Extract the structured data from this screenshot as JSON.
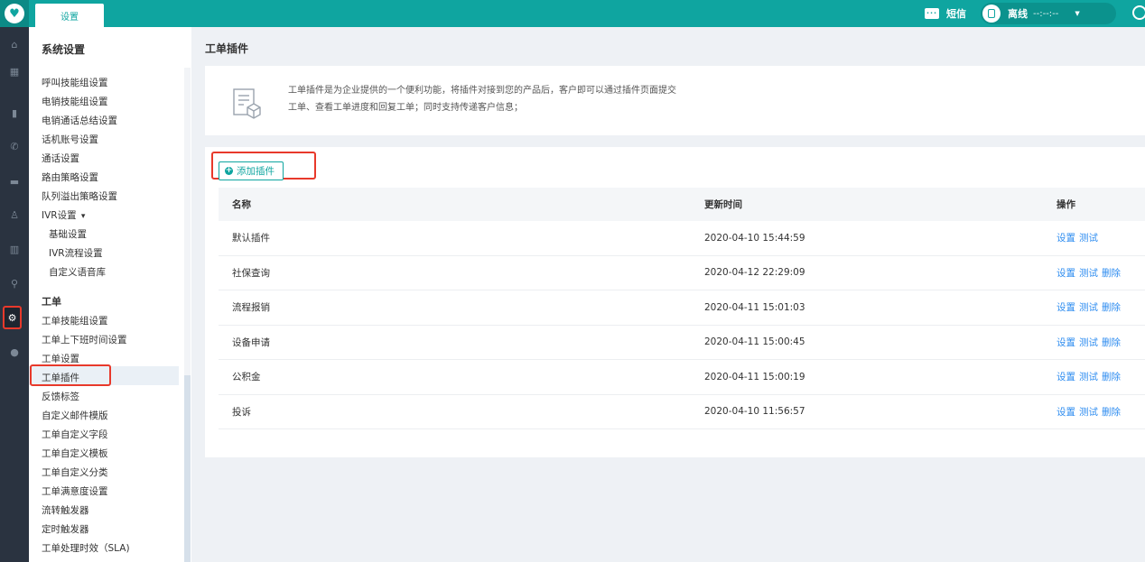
{
  "topbar": {
    "active_tab": "设置",
    "sms_label": "短信",
    "status_label": "离线",
    "status_time": "--:--:--"
  },
  "rail": {
    "icons": [
      "home-icon",
      "grid-icon",
      "book-icon",
      "phone-icon",
      "chat-icon",
      "users-icon",
      "chart-icon",
      "search-icon",
      "gear-icon",
      "github-icon"
    ],
    "active": "gear-icon"
  },
  "nav": {
    "title": "系统设置",
    "items": [
      {
        "label": "呼叫技能组设置"
      },
      {
        "label": "电销技能组设置"
      },
      {
        "label": "电销通话总结设置"
      },
      {
        "label": "话机账号设置"
      },
      {
        "label": "通话设置"
      },
      {
        "label": "路由策略设置"
      },
      {
        "label": "队列溢出策略设置"
      },
      {
        "label": "IVR设置"
      }
    ],
    "ivr_caret": "▾",
    "ivr_children": [
      {
        "label": "基础设置"
      },
      {
        "label": "IVR流程设置"
      },
      {
        "label": "自定义语音库"
      }
    ],
    "ticket_group": "工单",
    "ticket_items": [
      {
        "label": "工单技能组设置"
      },
      {
        "label": "工单上下班时间设置"
      },
      {
        "label": "工单设置"
      },
      {
        "label": "工单插件"
      },
      {
        "label": "反馈标签"
      },
      {
        "label": "自定义邮件模版"
      },
      {
        "label": "工单自定义字段"
      },
      {
        "label": "工单自定义模板"
      },
      {
        "label": "工单自定义分类"
      },
      {
        "label": "工单满意度设置"
      },
      {
        "label": "流转触发器"
      },
      {
        "label": "定时触发器"
      },
      {
        "label": "工单处理时效（SLA)"
      }
    ],
    "active_item": "工单插件"
  },
  "main": {
    "title": "工单插件",
    "intro_line1": "工单插件是为企业提供的一个便利功能，将插件对接到您的产品后，客户即可以通过插件页面提交",
    "intro_line2": "工单、查看工单进度和回复工单；同时支持传递客户信息；",
    "add_button": "添加插件",
    "columns": {
      "name": "名称",
      "time": "更新时间",
      "ops": "操作"
    },
    "rows": [
      {
        "name": "默认插件",
        "time": "2020-04-10 15:44:59",
        "ops": [
          "设置",
          "测试"
        ]
      },
      {
        "name": "社保查询",
        "time": "2020-04-12 22:29:09",
        "ops": [
          "设置",
          "测试",
          "删除"
        ]
      },
      {
        "name": "流程报销",
        "time": "2020-04-11 15:01:03",
        "ops": [
          "设置",
          "测试",
          "删除"
        ]
      },
      {
        "name": "设备申请",
        "time": "2020-04-11 15:00:45",
        "ops": [
          "设置",
          "测试",
          "删除"
        ]
      },
      {
        "name": "公积金",
        "time": "2020-04-11 15:00:19",
        "ops": [
          "设置",
          "测试",
          "删除"
        ]
      },
      {
        "name": "投诉",
        "time": "2020-04-10 11:56:57",
        "ops": [
          "设置",
          "测试",
          "删除"
        ]
      }
    ]
  }
}
